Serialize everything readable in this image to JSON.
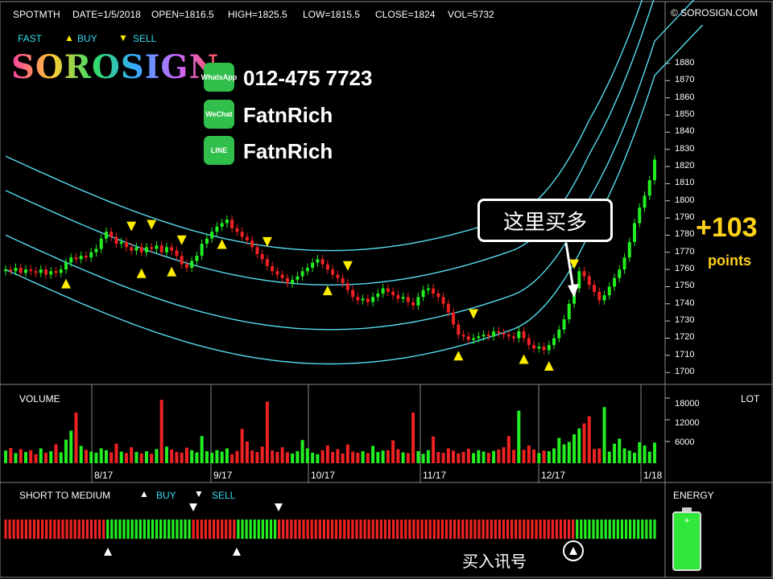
{
  "header": {
    "symbol": "SPOTMTH",
    "date": "DATE=1/5/2018",
    "open": "OPEN=1816.5",
    "high": "HIGH=1825.5",
    "low": "LOW=1815.5",
    "close": "CLOSE=1824",
    "vol": "VOL=5732",
    "copyright": "© SOROSIGN.COM"
  },
  "legend": {
    "fast": "FAST",
    "buy": "BUY",
    "sell": "SELL"
  },
  "logo": {
    "text": "SOROSIGN"
  },
  "contacts": [
    {
      "icon": "whatsapp-icon",
      "icon_label": "WhatsApp",
      "text": "012-475 7723",
      "color": "#2fbf4a"
    },
    {
      "icon": "wechat-icon",
      "icon_label": "WeChat",
      "text": "FatnRich",
      "color": "#2fbf4a"
    },
    {
      "icon": "line-icon",
      "icon_label": "LINE",
      "text": "FatnRich",
      "color": "#2fbf4a"
    }
  ],
  "callout": "这里买多",
  "gain": {
    "value": "+103",
    "unit": "points"
  },
  "volume_panel": {
    "title": "VOLUME",
    "unit": "LOT",
    "ticks": [
      "18000",
      "12000",
      "6000"
    ]
  },
  "signal_panel": {
    "title": "SHORT TO MEDIUM",
    "buy": "BUY",
    "sell": "SELL",
    "signal_label": "买入讯号"
  },
  "energy_panel": {
    "title": "ENERGY"
  },
  "colors": {
    "up": "#22ee22",
    "down": "#ee2222",
    "band": "#55ddee",
    "marker": "#ffee00",
    "gain": "#ffd21a"
  },
  "chart_data": {
    "type": "candlestick",
    "price_axis": {
      "ticks": [
        1880,
        1870,
        1860,
        1850,
        1840,
        1830,
        1820,
        1810,
        1800,
        1790,
        1780,
        1770,
        1760,
        1750,
        1740,
        1730,
        1720,
        1710,
        1700
      ],
      "range": [
        1694,
        1887
      ]
    },
    "x_tick_labels": [
      "8/17",
      "9/17",
      "10/17",
      "11/17",
      "12/17",
      "1/18"
    ],
    "closes": [
      1760,
      1759,
      1761,
      1758,
      1760,
      1759,
      1758,
      1760,
      1757,
      1759,
      1758,
      1760,
      1764,
      1767,
      1766,
      1768,
      1767,
      1770,
      1772,
      1778,
      1782,
      1779,
      1775,
      1776,
      1773,
      1771,
      1773,
      1770,
      1773,
      1772,
      1774,
      1770,
      1773,
      1771,
      1768,
      1763,
      1761,
      1765,
      1768,
      1775,
      1778,
      1782,
      1785,
      1787,
      1789,
      1784,
      1782,
      1779,
      1777,
      1773,
      1769,
      1766,
      1762,
      1759,
      1757,
      1755,
      1752,
      1754,
      1756,
      1759,
      1761,
      1764,
      1766,
      1763,
      1760,
      1757,
      1755,
      1752,
      1748,
      1744,
      1742,
      1743,
      1741,
      1744,
      1746,
      1749,
      1747,
      1745,
      1743,
      1744,
      1741,
      1739,
      1744,
      1748,
      1749,
      1746,
      1744,
      1740,
      1735,
      1728,
      1722,
      1721,
      1719,
      1720,
      1721,
      1722,
      1721,
      1724,
      1723,
      1722,
      1721,
      1720,
      1724,
      1720,
      1716,
      1714,
      1715,
      1713,
      1716,
      1720,
      1725,
      1731,
      1740,
      1749,
      1759,
      1756,
      1751,
      1747,
      1742,
      1745,
      1750,
      1755,
      1760,
      1767,
      1776,
      1787,
      1796,
      1803,
      1812,
      1824
    ],
    "volume": [
      3500,
      4200,
      2800,
      3900,
      3100,
      3600,
      2500,
      4100,
      2900,
      3300,
      5200,
      3000,
      6500,
      9000,
      14000,
      4800,
      3700,
      3200,
      2900,
      4100,
      3600,
      3000,
      5400,
      3200,
      2800,
      4400,
      3100,
      2700,
      3300,
      2600,
      3900,
      17500,
      4600,
      3800,
      3100,
      2900,
      4300,
      3600,
      3000,
      7500,
      3300,
      2900,
      3600,
      3200,
      4100,
      2500,
      3400,
      9500,
      6000,
      3500,
      3100,
      4600,
      17000,
      3500,
      3100,
      4400,
      3000,
      2700,
      3300,
      6400,
      4100,
      2900,
      2500,
      3600,
      4900,
      3100,
      3900,
      2700,
      5200,
      3200,
      2900,
      3300,
      2800,
      4800,
      3100,
      3500,
      3600,
      6300,
      3900,
      3000,
      2800,
      14000,
      3300,
      2600,
      3600,
      7400,
      3100,
      2900,
      4100,
      3500,
      2700,
      3100,
      4000,
      2800,
      3600,
      3200,
      2900,
      3400,
      3800,
      4400,
      7500,
      3700,
      14500,
      3700,
      4900,
      3800,
      2800,
      3500,
      3300,
      4100,
      7000,
      5200,
      5900,
      8000,
      9600,
      11000,
      13000,
      3900,
      4100,
      15500,
      3200,
      5400,
      6800,
      4100,
      3500,
      2900,
      5800,
      4900,
      3200,
      5700
    ],
    "signal": "sell: bars 1-31, 73-89, 103-118; buy: bars 32-72, 90-102, 119-130"
  }
}
